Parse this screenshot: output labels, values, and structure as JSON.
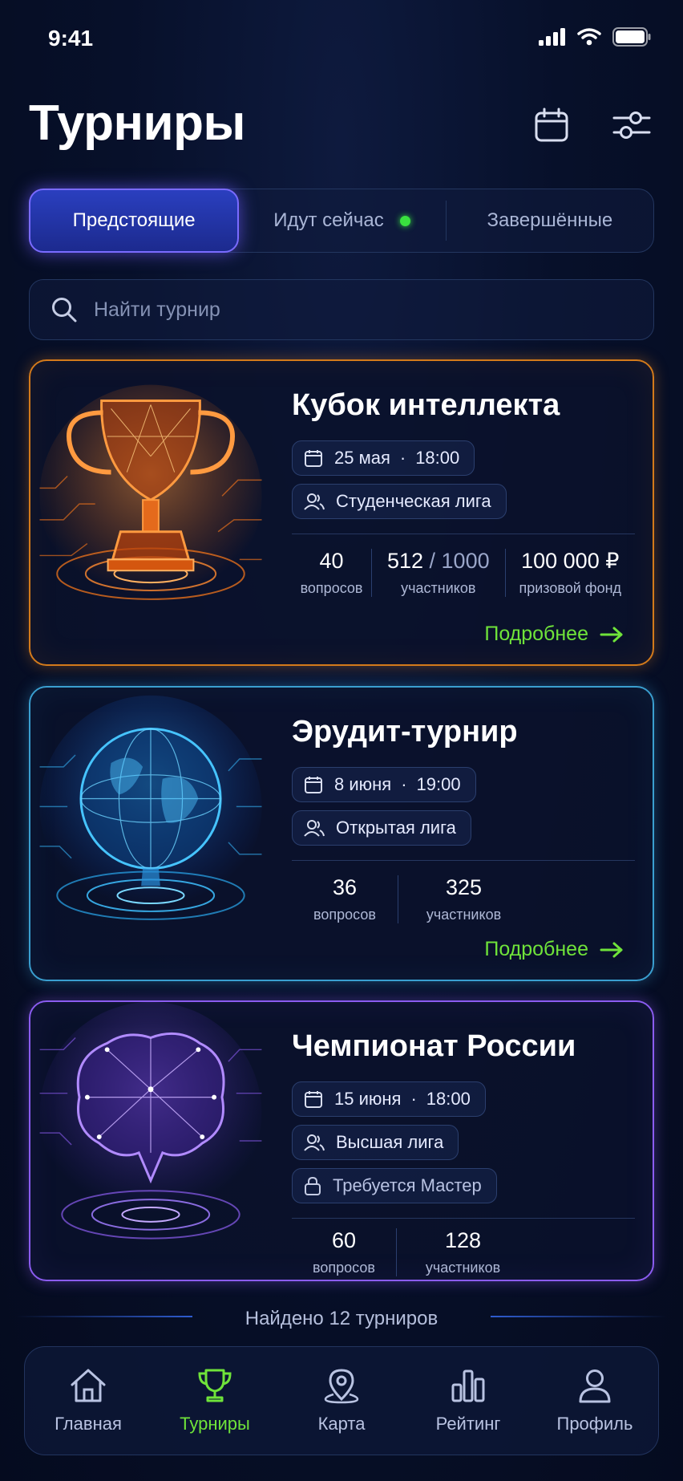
{
  "status_bar": {
    "time": "9:41"
  },
  "header": {
    "title": "Турниры"
  },
  "tabs": [
    {
      "label": "Предстоящие",
      "active": true
    },
    {
      "label": "Идут сейчас",
      "live_indicator": true
    },
    {
      "label": "Завершённые"
    }
  ],
  "search": {
    "placeholder": "Найти турнир"
  },
  "tournaments": [
    {
      "title": "Кубок интеллекта",
      "date": "25 мая",
      "time": "18:00",
      "league": "Студенческая лига",
      "stats": {
        "questions": "40",
        "questions_label": "вопросов",
        "participants": "512",
        "participants_max": "/ 1000",
        "participants_label": "участников",
        "prize": "100 000 ₽",
        "prize_label": "призовой фонд"
      },
      "more": "Подробнее",
      "accent": "#d37a1b",
      "art_icon": "trophy-icon"
    },
    {
      "title": "Эрудит-турнир",
      "date": "8 июня",
      "time": "19:00",
      "league": "Открытая лига",
      "stats": {
        "questions": "36",
        "questions_label": "вопросов",
        "participants": "325",
        "participants_label": "участников"
      },
      "more": "Подробнее",
      "accent": "#3a9fd0",
      "art_icon": "globe-icon"
    },
    {
      "title": "Чемпионат России",
      "date": "15 июня",
      "time": "18:00",
      "league": "Высшая лига",
      "requirement": "Требуется Мастер",
      "stats": {
        "questions": "60",
        "questions_label": "вопросов",
        "participants": "128",
        "participants_label": "участников"
      },
      "accent": "#8b5cf0",
      "art_icon": "brain-icon"
    }
  ],
  "found_text": "Найдено 12 турниров",
  "nav": [
    {
      "label": "Главная",
      "icon": "home-icon"
    },
    {
      "label": "Турниры",
      "icon": "trophy-icon",
      "active": true
    },
    {
      "label": "Карта",
      "icon": "map-pin-icon"
    },
    {
      "label": "Рейтинг",
      "icon": "bar-chart-icon"
    },
    {
      "label": "Профиль",
      "icon": "user-icon"
    }
  ],
  "colors": {
    "accent_green": "#6fe33a",
    "active_tab": "#2a3fbf",
    "live_dot": "#39e23f"
  }
}
